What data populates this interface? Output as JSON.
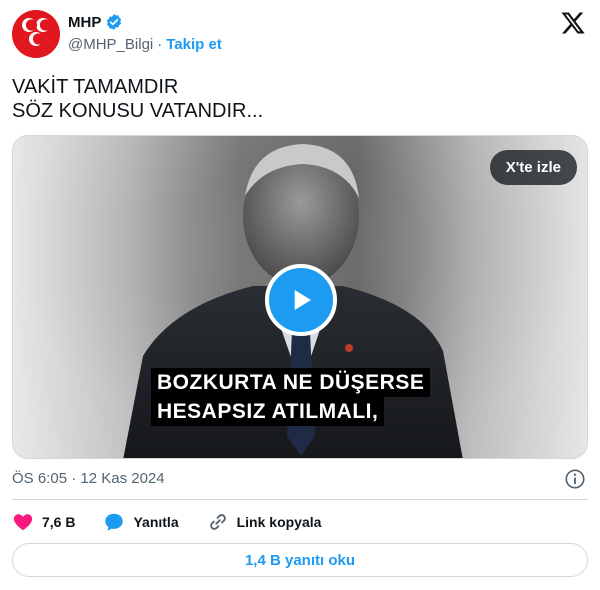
{
  "author": {
    "display_name": "MHP",
    "handle": "@MHP_Bilgi",
    "separator": "·",
    "follow_label": "Takip et",
    "avatar_icon": "mhp-crescents-logo",
    "verified_icon": "verified-badge-icon"
  },
  "tweet": {
    "lines": [
      "VAKİT TAMAMDIR",
      "SÖZ KONUSU VATANDIR..."
    ]
  },
  "media": {
    "watch_label": "X'te izle",
    "caption_lines": [
      "BOZKURTA NE DÜŞERSE",
      "HESAPSIZ ATILMALI,"
    ]
  },
  "meta": {
    "timestamp": "ÖS 6:05 · 12 Kas 2024"
  },
  "actions": {
    "like_count": "7,6 B",
    "reply_label": "Yanıtla",
    "copy_link_label": "Link kopyala"
  },
  "replies_button": "1,4 B yanıtı oku",
  "colors": {
    "accent": "#1d9bf0",
    "like": "#f91880",
    "brand_red": "#e2161f",
    "muted": "#536471"
  }
}
